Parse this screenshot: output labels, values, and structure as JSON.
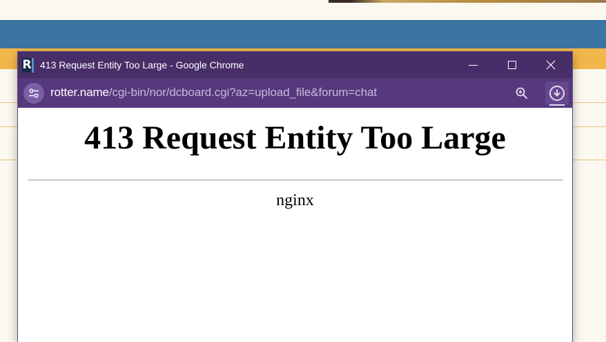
{
  "window": {
    "title": "413 Request Entity Too Large - Google Chrome",
    "favicon_letter": "R",
    "controls": {
      "minimize": "minimize-icon",
      "maximize": "maximize-icon",
      "close": "close-icon"
    }
  },
  "addressbar": {
    "site_info_icon": "tune-icon",
    "url_domain": "rotter.name",
    "url_path": "/cgi-bin/nor/dcboard.cgi?az=upload_file&forum=chat",
    "zoom_icon": "zoom-in-icon",
    "download_icon": "download-icon"
  },
  "page": {
    "heading": "413 Request Entity Too Large",
    "server": "nginx"
  },
  "colors": {
    "titlebar": "#472e68",
    "addressbar": "#56387d",
    "background_blue": "#3b75a3",
    "background_orange": "#f2b74a"
  }
}
